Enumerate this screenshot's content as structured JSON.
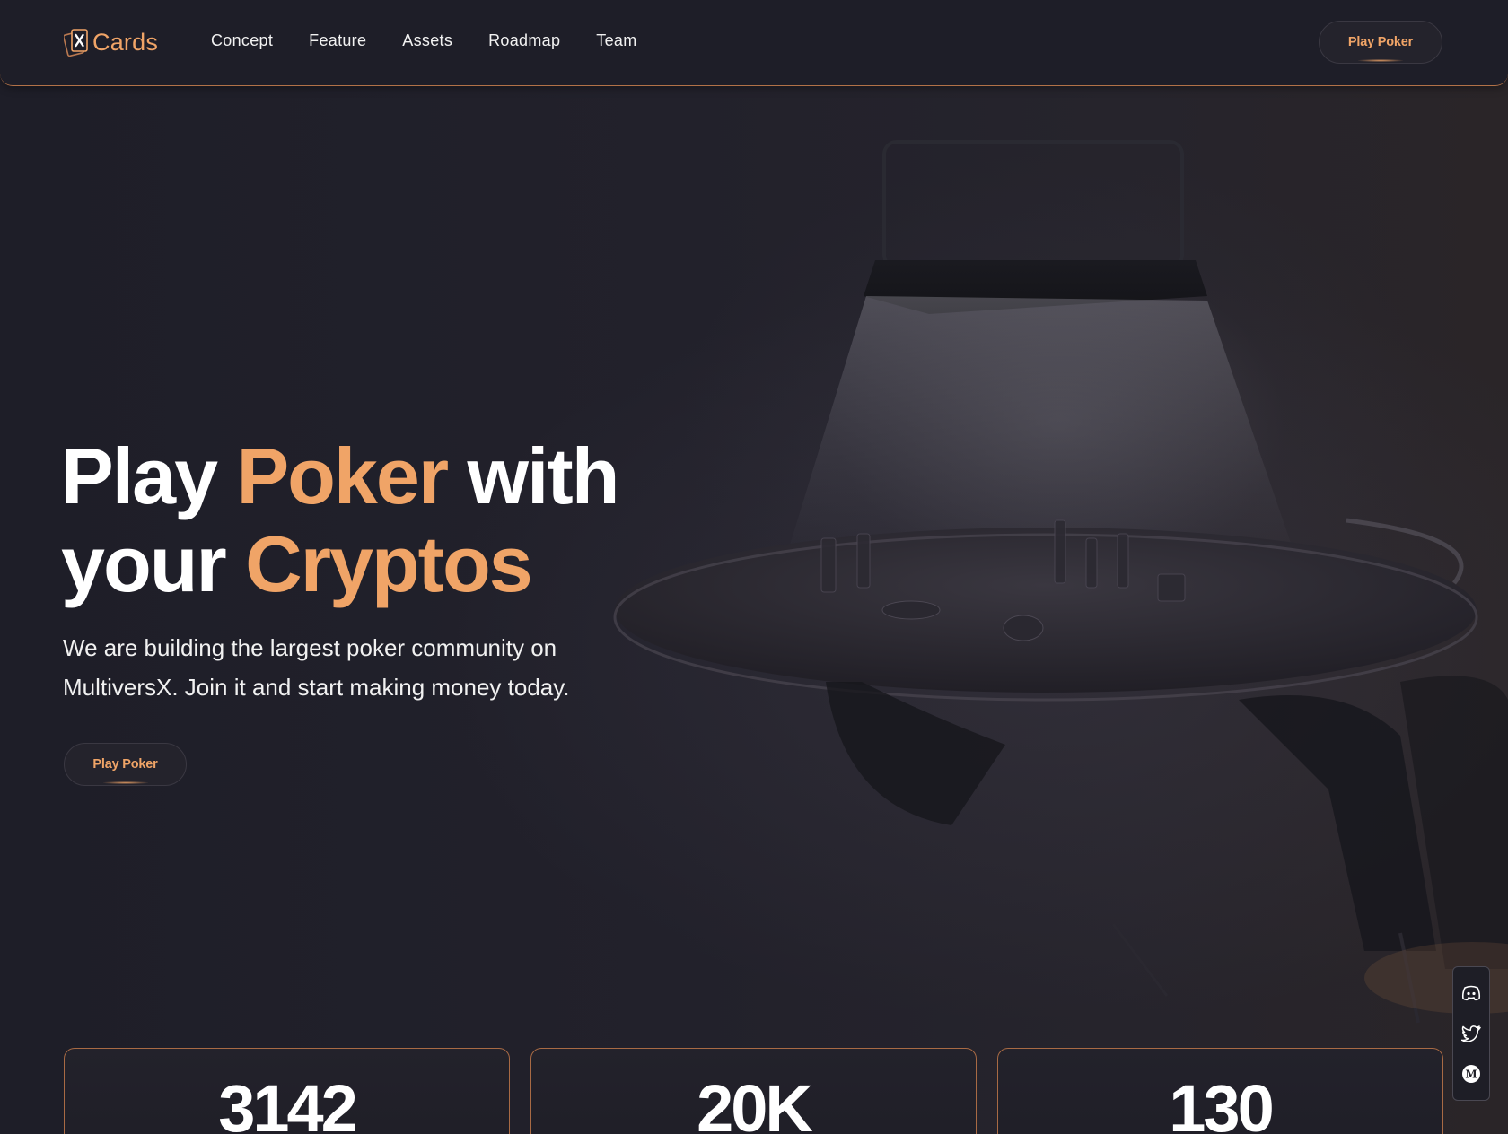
{
  "brand": {
    "name": "Cards",
    "accent_color": "#f0a467",
    "logo_icon": "x-card-icon"
  },
  "nav": {
    "items": [
      {
        "label": "Concept"
      },
      {
        "label": "Feature"
      },
      {
        "label": "Assets"
      },
      {
        "label": "Roadmap"
      },
      {
        "label": "Team"
      }
    ],
    "cta_label": "Play Poker"
  },
  "hero": {
    "title_parts": [
      {
        "text": "Play ",
        "highlight": false
      },
      {
        "text": "Poker",
        "highlight": true
      },
      {
        "text": " with",
        "highlight": false
      },
      {
        "text": "your ",
        "highlight": false
      },
      {
        "text": "Cryptos",
        "highlight": true
      }
    ],
    "subtitle": "We are building the largest poker community on MultiversX. Join it and start making money today.",
    "cta_label": "Play Poker"
  },
  "social": [
    {
      "icon": "discord-icon"
    },
    {
      "icon": "twitter-icon"
    },
    {
      "icon": "medium-icon"
    }
  ],
  "stats": [
    {
      "value": "3142"
    },
    {
      "value": "20K"
    },
    {
      "value": "130"
    }
  ]
}
